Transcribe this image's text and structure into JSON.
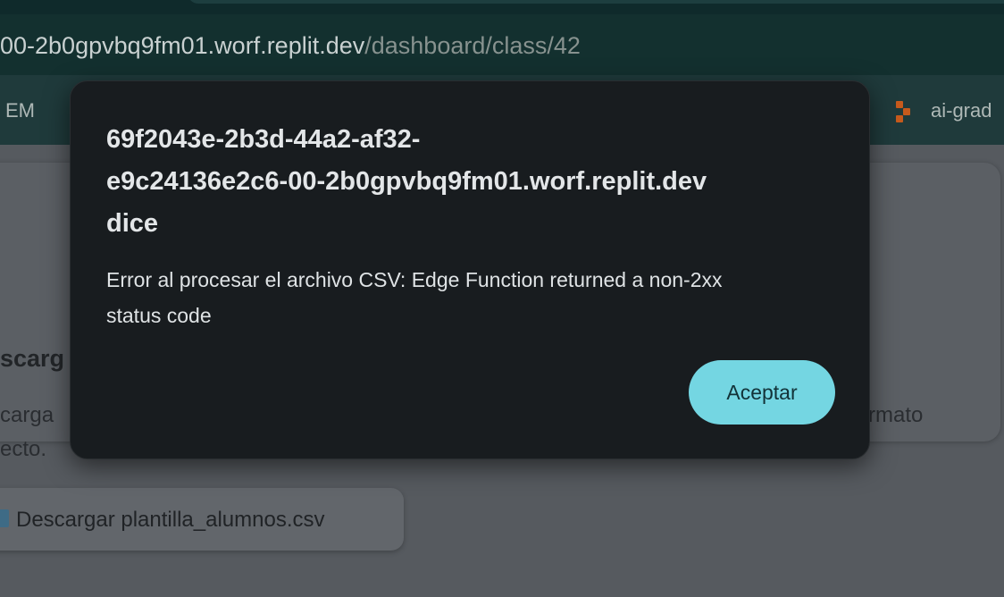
{
  "browser": {
    "url_host": "00-2b0gpvbq9fm01.worf.replit.dev",
    "url_path": "/dashboard/class/42",
    "bookmarks": [
      {
        "label": "EM"
      },
      {
        "label": "ai-grad",
        "icon": "replit-icon"
      }
    ]
  },
  "page": {
    "section_title": "scarg",
    "description_line1": "carga",
    "description_line2": "ecto.",
    "description_right": "rmato",
    "download_button_label": "Descargar plantilla_alumnos.csv",
    "download_icon": "file-icon"
  },
  "dialog": {
    "title": "69f2043e-2b3d-44a2-af32-e9c24136e2c6-00-2b0gpvbq9fm01.worf.replit.dev dice",
    "title_line1": "69f2043e-2b3d-44a2-af32-",
    "title_line2": "e9c24136e2c6-00-2b0gpvbq9fm01.worf.replit.dev",
    "title_line3": "dice",
    "message": "Error al procesar el archivo CSV: Edge Function returned a non-2xx status code",
    "accept_label": "Aceptar",
    "accent_color": "#74d6e2"
  }
}
